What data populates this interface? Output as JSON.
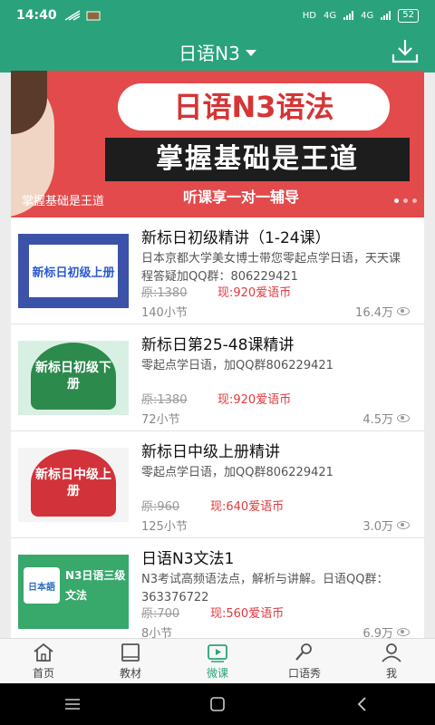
{
  "status_bar": {
    "time": "14:40",
    "network_left": "HD",
    "net1": "4G",
    "net2": "4G",
    "battery": "52"
  },
  "header": {
    "title": "日语N3"
  },
  "banner": {
    "title": "日语N3语法",
    "subtitle": "掌握基础是王道",
    "tagline": "听课享一对一辅导",
    "caption": "掌握基础是王道"
  },
  "courses": [
    {
      "title": "新标日初级精讲（1-24课）",
      "desc": "日本京都大学美女博士带您零起点学日语，天天课程答疑加QQ群：806229421",
      "orig_price": "原:1380",
      "price": "现:920爱语币",
      "lessons": "140小节",
      "views": "16.4万",
      "thumb_text": "新标日初级上册"
    },
    {
      "title": "新标日第25-48课精讲",
      "desc": "零起点学日语，加QQ群806229421",
      "orig_price": "原:1380",
      "price": "现:920爱语币",
      "lessons": "72小节",
      "views": "4.5万",
      "thumb_text": "新标日初级下册"
    },
    {
      "title": "新标日中级上册精讲",
      "desc": "零起点学日语，加QQ群806229421",
      "orig_price": "原:960",
      "price": "现:640爱语币",
      "lessons": "125小节",
      "views": "3.0万",
      "thumb_text": "新标日中级上册"
    },
    {
      "title": "日语N3文法1",
      "desc": "N3考试高频语法点，解析与讲解。日语QQ群：363376722",
      "orig_price": "原:700",
      "price": "现:560爱语币",
      "lessons": "8小节",
      "views": "6.9万",
      "thumb_logo": "日本語",
      "thumb_text": "N3日语三级 文法"
    }
  ],
  "tabs": [
    {
      "label": "首页",
      "icon": "home-icon"
    },
    {
      "label": "教材",
      "icon": "book-icon"
    },
    {
      "label": "微课",
      "icon": "play-icon",
      "active": true
    },
    {
      "label": "口语秀",
      "icon": "microphone-icon"
    },
    {
      "label": "我",
      "icon": "user-icon"
    }
  ],
  "colors": {
    "primary": "#2aa37c",
    "price_red": "#e0393e",
    "banner_red": "#e24a4c"
  }
}
